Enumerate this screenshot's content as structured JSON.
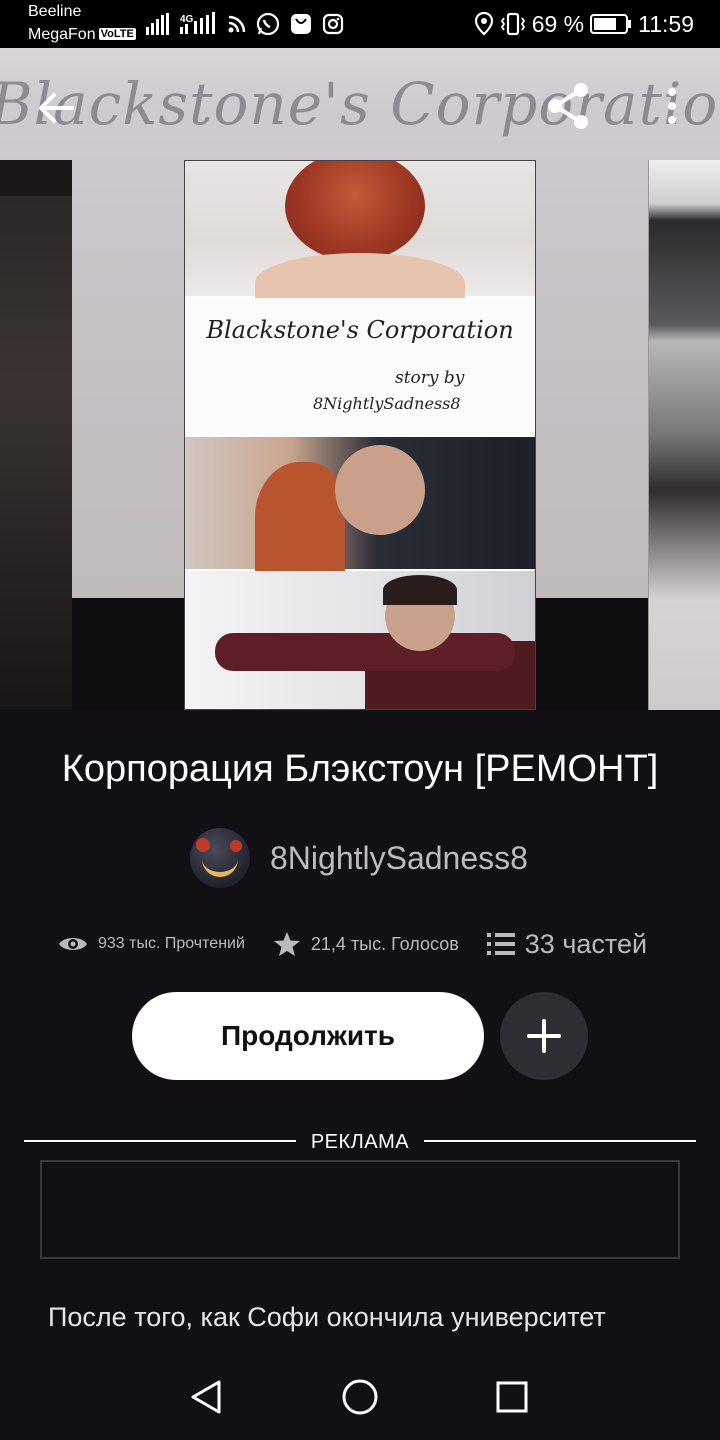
{
  "status_bar": {
    "carrier_1": "Beeline",
    "carrier_2": "MegaFon",
    "volte_badge": "VoLTE",
    "network_label": "4G",
    "battery_percent": "69 %",
    "time": "11:59",
    "icons": [
      "signal-bars-icon",
      "signal-4g-icon",
      "rss-icon",
      "whatsapp-icon",
      "huawei-app-icon",
      "instagram-icon",
      "location-icon",
      "vibrate-icon",
      "battery-icon"
    ]
  },
  "header": {
    "icons": [
      "back-arrow-icon",
      "share-icon",
      "more-vertical-icon"
    ]
  },
  "cover": {
    "title_script": "Blackstone's Corporation",
    "byline_1": "story by",
    "byline_2": "8NightlySadness8"
  },
  "story": {
    "title": "Корпорация Блэкстоун [РЕМОНТ]",
    "author": "8NightlySadness8",
    "reads": "933 тыс. Прочтений",
    "votes": "21,4 тыс. Голосов",
    "parts": "33 частей",
    "description": "После того, как Софи окончила университет"
  },
  "actions": {
    "continue_label": "Продолжить",
    "add_icon": "plus-icon"
  },
  "ad": {
    "label": "РЕКЛАМА"
  },
  "nav_bar": {
    "icons": [
      "nav-back-icon",
      "nav-home-icon",
      "nav-recents-icon"
    ]
  },
  "colors": {
    "background": "#121015",
    "primary_button": "#ffffff",
    "secondary_button": "#2f2d33",
    "muted_text": "#bcb8bf"
  }
}
